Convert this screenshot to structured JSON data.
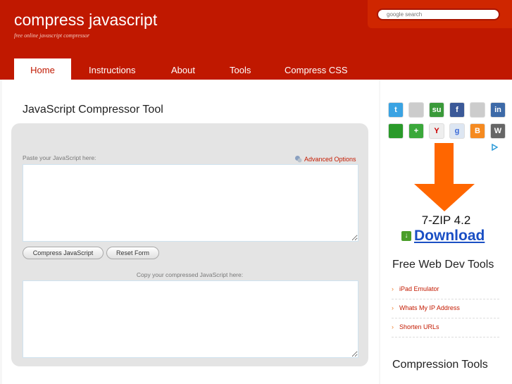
{
  "header": {
    "logo": "compress javascript",
    "tagline": "free online javascript compressor",
    "search_placeholder": "google search"
  },
  "nav": [
    {
      "label": "Home",
      "active": true
    },
    {
      "label": "Instructions"
    },
    {
      "label": "About"
    },
    {
      "label": "Tools"
    },
    {
      "label": "Compress CSS"
    }
  ],
  "main": {
    "title": "JavaScript Compressor Tool",
    "paste_label": "Paste your JavaScript here:",
    "advanced_options": "Advanced Options",
    "compress_button": "Compress JavaScript",
    "reset_button": "Reset Form",
    "copy_label": "Copy your compressed JavaScript here:",
    "input_value": "",
    "output_value": ""
  },
  "sidebar": {
    "social": [
      {
        "name": "twitter",
        "g": "t",
        "c": "#3aa3e3"
      },
      {
        "name": "delicious",
        "g": "",
        "c": "#ccc"
      },
      {
        "name": "stumbleupon",
        "g": "su",
        "c": "#3a9a3a"
      },
      {
        "name": "facebook",
        "g": "f",
        "c": "#3b5998"
      },
      {
        "name": "myspace",
        "g": "",
        "c": "#ccc"
      },
      {
        "name": "linkedin",
        "g": "in",
        "c": "#3d6aa8"
      },
      {
        "name": "technorati",
        "g": "",
        "c": "#2a9a2a"
      },
      {
        "name": "add",
        "g": "+",
        "c": "#3aa83a"
      },
      {
        "name": "yahoo",
        "g": "Y",
        "c": "#eee"
      },
      {
        "name": "google",
        "g": "g",
        "c": "#dde6f2"
      },
      {
        "name": "blogger",
        "g": "B",
        "c": "#f58a20"
      },
      {
        "name": "wordpress",
        "g": "W",
        "c": "#666"
      }
    ],
    "ad": {
      "product": "7-ZIP 4.2",
      "download": "Download"
    },
    "free_tools_heading": "Free Web Dev Tools",
    "free_tools": [
      "iPad Emulator",
      "Whats My IP Address",
      "Shorten URLs"
    ],
    "compression_heading": "Compression Tools"
  },
  "colors": {
    "brand": "#c01800",
    "link": "#c41a00",
    "arrow": "#ff6600"
  }
}
